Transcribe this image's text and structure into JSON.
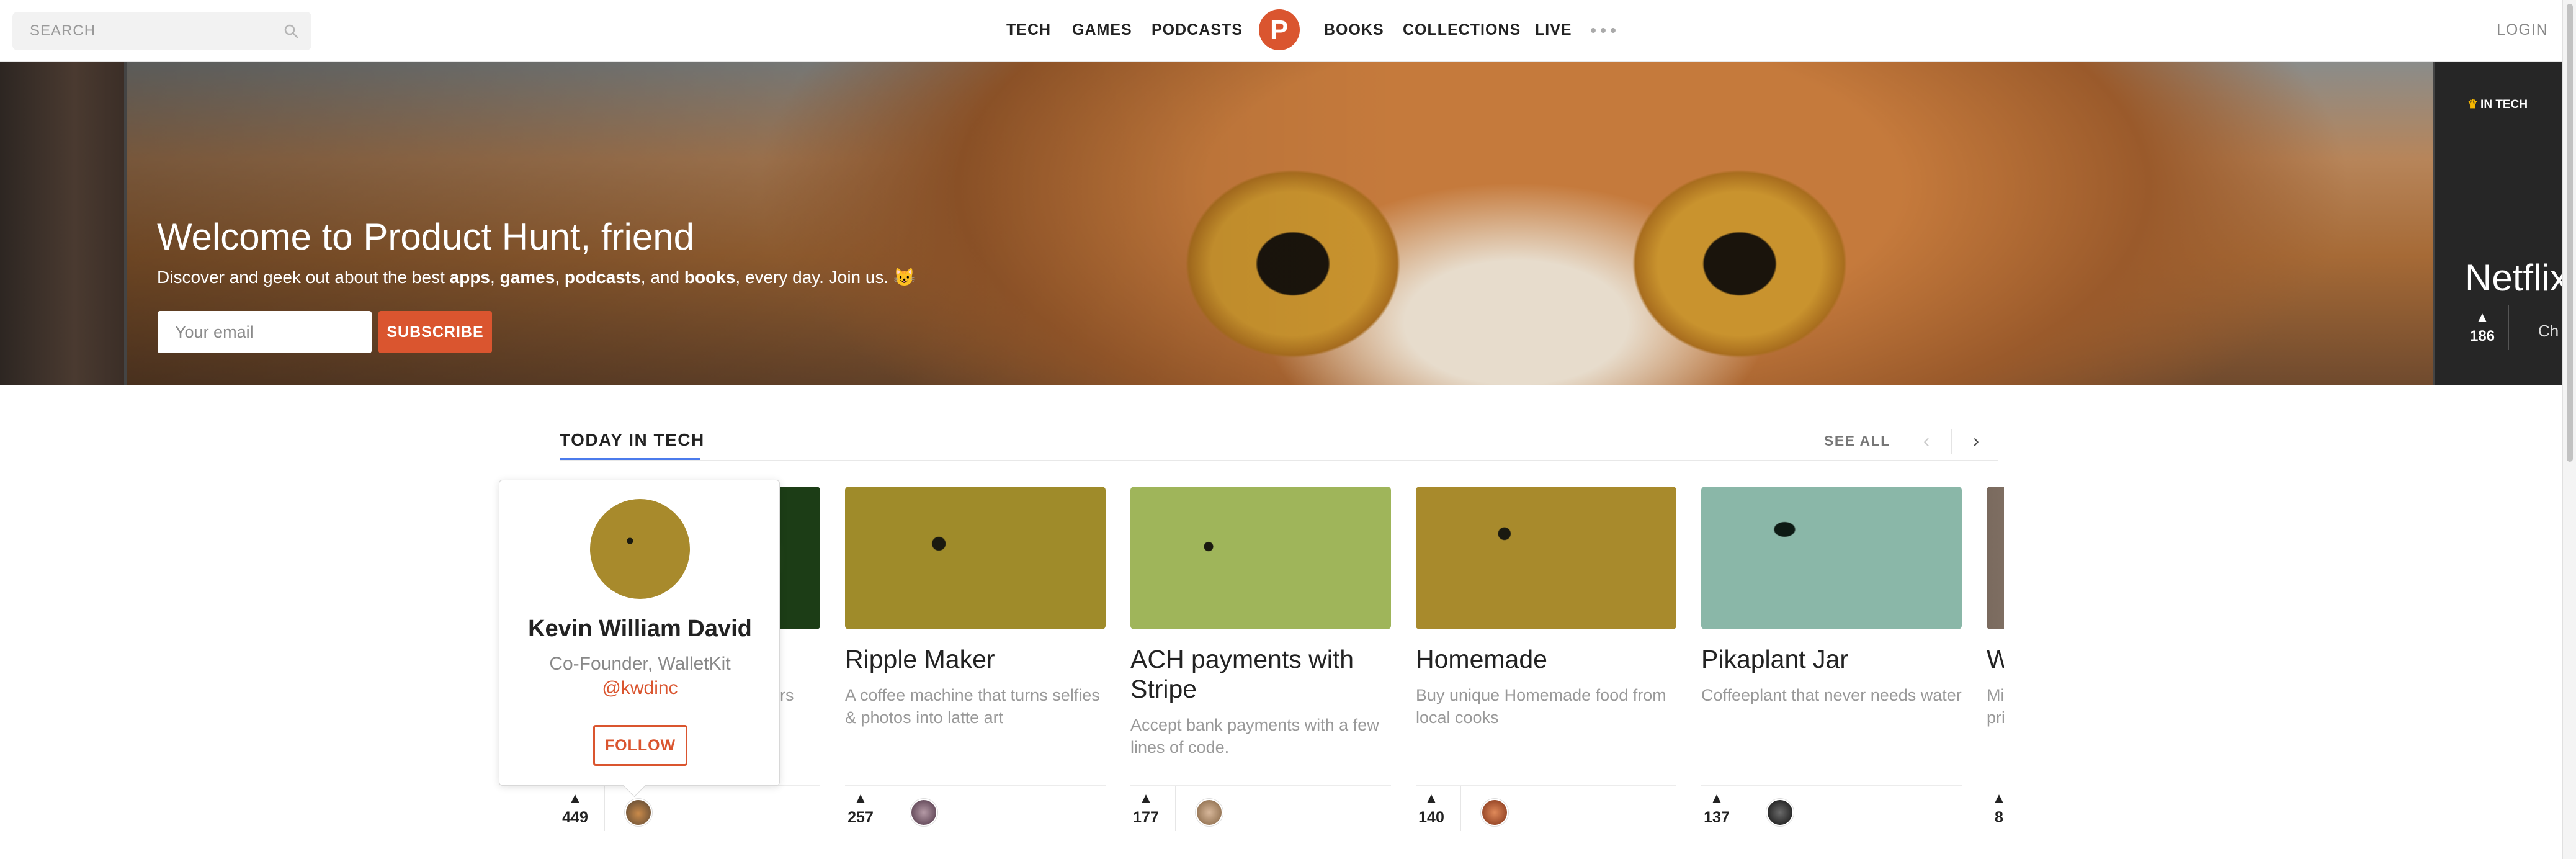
{
  "header": {
    "search_placeholder": "SEARCH",
    "nav": {
      "tech": "TECH",
      "games": "GAMES",
      "podcasts": "PODCASTS",
      "logo_letter": "P",
      "books": "BOOKS",
      "collections": "COLLECTIONS",
      "live": "LIVE"
    },
    "login": "LOGIN"
  },
  "hero": {
    "title": "Welcome to Product Hunt, friend",
    "subtitle": {
      "t1": "Discover and geek out about the best ",
      "apps": "apps",
      "c1": ", ",
      "games": "games",
      "c2": ", ",
      "podcasts": "podcasts",
      "c3": ", and ",
      "books": "books",
      "t2": ", every day. Join us. ",
      "emoji": "😺"
    },
    "email_placeholder": "Your email",
    "subscribe_label": "SUBSCRIBE",
    "featured": {
      "badge": "IN TECH",
      "title": "Netflix",
      "votes": "186",
      "snippet": "Ch"
    }
  },
  "section": {
    "title": "TODAY IN TECH",
    "see_all": "SEE ALL"
  },
  "posts": [
    {
      "name": "",
      "description": "ers",
      "votes": "449"
    },
    {
      "name": "Ripple Maker",
      "description": "A coffee machine that turns selfies & photos into latte art",
      "votes": "257"
    },
    {
      "name": "ACH payments with Stripe",
      "description": "Accept bank payments with a few lines of code.",
      "votes": "177"
    },
    {
      "name": "Homemade",
      "description": "Buy unique Homemade food from local cooks",
      "votes": "140"
    },
    {
      "name": "Pikaplant Jar",
      "description": "Coffeeplant that never needs water",
      "votes": "137"
    },
    {
      "name": "W",
      "description": "Mi pri",
      "votes": "8"
    }
  ],
  "popover": {
    "name": "Kevin William David",
    "role": "Co-Founder, WalletKit",
    "handle": "@kwdinc",
    "follow_label": "FOLLOW"
  },
  "colors": {
    "accent": "#da552f",
    "tab_underline": "#4b7bec"
  }
}
